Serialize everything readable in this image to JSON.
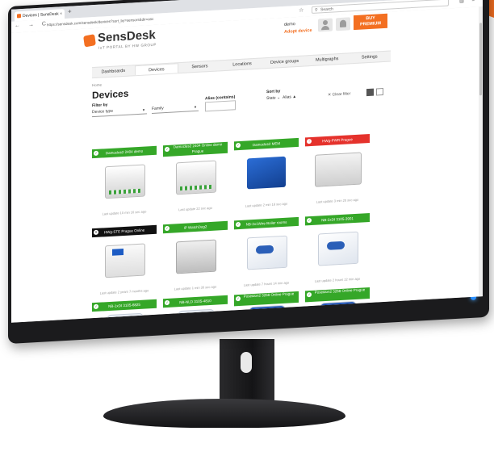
{
  "browser": {
    "tab_title": "Devices | SensDesk",
    "tab_close": "×",
    "new_tab": "+",
    "window_controls": "–  ▢  ✕",
    "nav_buttons": "←  →  C",
    "url_host": "sensdesk.com",
    "url_full": "https://sensdesk.com/sensdesk/devices?sort_by=sensors&dir=asc",
    "search_placeholder": "Search",
    "menu_icons": "▥  ≡"
  },
  "header": {
    "logo_text_a": "Sens",
    "logo_text_b": "Desk",
    "logo_subtitle": "IoT PORTAL BY HW GROUP",
    "username": "demo",
    "adopt_device": "Adopt device",
    "buy_premium_line1": "BUY",
    "buy_premium_line2": "PREMIUM"
  },
  "menu": [
    {
      "label": "Dashboards",
      "active": false
    },
    {
      "label": "Devices",
      "active": true
    },
    {
      "label": "Sensors",
      "active": false
    },
    {
      "label": "Locations",
      "active": false
    },
    {
      "label": "Device groups",
      "active": false
    },
    {
      "label": "Multigraphs",
      "active": false
    },
    {
      "label": "Settings",
      "active": false
    }
  ],
  "breadcrumb": "Home",
  "page_title": "Devices",
  "filters": {
    "filter_by_label": "Filter by",
    "device_type_label": "Device type",
    "family_label": "Family",
    "alias_label": "Alias (contains)",
    "alias_value": "",
    "sort_by_label": "Sort by",
    "sort_state": "State",
    "sort_alias": "Alias ▲",
    "clear_filter": "Clear filter"
  },
  "cards": [
    {
      "name": "Damocles2 2404 demo",
      "status": "ok",
      "updated": "Last update 10 min 16 sec ago",
      "device": "d-rail"
    },
    {
      "name": "Damocles2 2404 Online demo Prague",
      "status": "ok",
      "updated": "Last update 22 sec ago",
      "device": "d-rail"
    },
    {
      "name": "Damocles2 MEM",
      "status": "ok",
      "updated": "Last update 2 min 18 sec ago",
      "device": "d-blue"
    },
    {
      "name": "HWg-PWR Prague",
      "status": "err",
      "updated": "Last update 3 min 20 sec ago",
      "device": "d-wide"
    },
    {
      "name": "HWg-STE Prague Online",
      "status": "off",
      "updated": "Last update 2 years 7 months ago",
      "device": "d-stack"
    },
    {
      "name": "IP WatchDog2",
      "status": "ok",
      "updated": "Last update 1 min 30 sec ago",
      "device": "d-grey"
    },
    {
      "name": "NB-2x1Wire Boiler rooms",
      "status": "ok",
      "updated": "Last update 7 hours 14 min ago",
      "device": "d-white"
    },
    {
      "name": "NB-2xDI 3105-3901",
      "status": "ok",
      "updated": "Last update 2 hours 22 min ago",
      "device": "d-white"
    },
    {
      "name": "NB-1xDI 3105-6825",
      "status": "ok",
      "updated": "",
      "device": "peek-white"
    },
    {
      "name": "NB-NLD 3105-4810",
      "status": "ok",
      "updated": "",
      "device": "peek-white"
    },
    {
      "name": "Poseidon2 3268 Online Prague",
      "status": "ok",
      "updated": "",
      "device": "peek-blue"
    },
    {
      "name": "Poseidon2 3268 Online Prague",
      "status": "ok",
      "updated": "",
      "device": "peek-blue"
    }
  ],
  "colors": {
    "brand": "#f36f21",
    "ok": "#35a728",
    "error": "#e5322c",
    "offline": "#111111"
  }
}
